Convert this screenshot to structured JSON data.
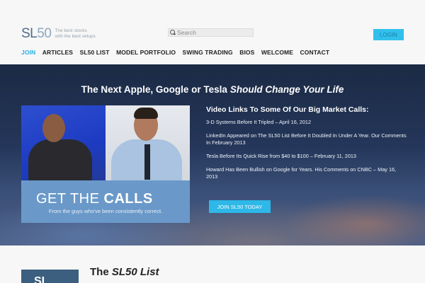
{
  "header": {
    "logo_main": "SL",
    "logo_num": "50",
    "tagline_line1": "The best stocks",
    "tagline_line2": "with the best setups",
    "search_placeholder": "Search",
    "login_label": "LOGIN"
  },
  "nav": {
    "items": [
      {
        "label": "JOIN",
        "active": true
      },
      {
        "label": "ARTICLES"
      },
      {
        "label": "SL50 LIST"
      },
      {
        "label": "MODEL PORTFOLIO"
      },
      {
        "label": "SWING TRADING"
      },
      {
        "label": "BIOS"
      },
      {
        "label": "WELCOME"
      },
      {
        "label": "CONTACT"
      }
    ]
  },
  "hero": {
    "title_plain": "The Next Apple, Google or Tesla",
    "title_italic": "Should Change Your Life",
    "promo_headline_light": "GET THE",
    "promo_headline_bold": "CALLS",
    "promo_sub": "From the guys who've been consistently correct.",
    "links_title": "Video Links To Some Of Our Big Market Calls:",
    "links": [
      "3-D Systems Before It Tripled – April 16, 2012",
      "LinkedIn Appeared on The SL50 List Before It Doubled In Under A Year. Our Comments In February 2013",
      "Tesla Before Its Quick Rise from $40 to $100 – February 11, 2013",
      "Howard Has Been Bullish on Google for Years. His Comments on CNBC – May 16, 2013"
    ],
    "join_label": "JOIN SL50 TODAY"
  },
  "bottom": {
    "logo_text": "SL",
    "title_plain": "The",
    "title_italic": "SL50 List"
  },
  "colors": {
    "accent": "#24b0df",
    "login_bg": "#31c0ec",
    "hero_dark": "#1b2a44",
    "promo_blue": "#6a99c9"
  }
}
